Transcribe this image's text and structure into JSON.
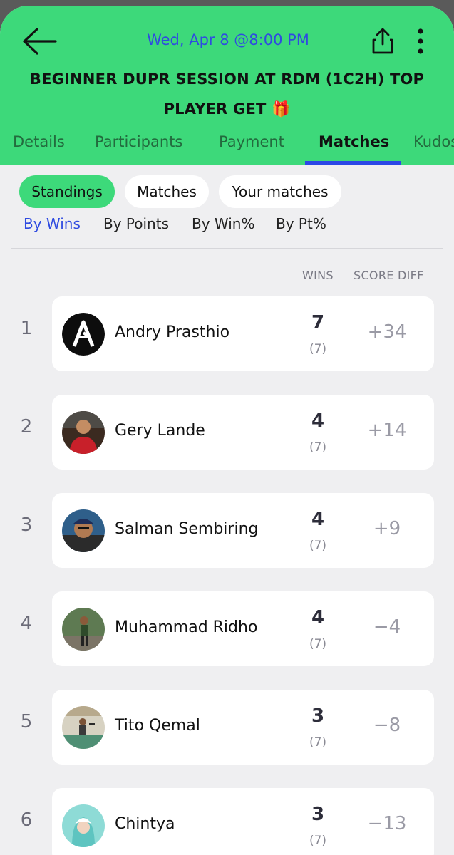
{
  "header": {
    "date": "Wed, Apr 8 @8:00 PM",
    "title_line1": "BEGINNER DUPR SESSION AT RDM (1C2H) TOP",
    "title_line2": "PLAYER GET 🎁"
  },
  "tabs": [
    {
      "label": "Details"
    },
    {
      "label": "Participants"
    },
    {
      "label": "Payment"
    },
    {
      "label": "Matches",
      "active": true
    },
    {
      "label": "Kudos"
    }
  ],
  "chips": [
    {
      "label": "Standings",
      "active": true
    },
    {
      "label": "Matches"
    },
    {
      "label": "Your matches"
    }
  ],
  "sorts": [
    {
      "label": "By Wins",
      "active": true
    },
    {
      "label": "By Points"
    },
    {
      "label": "By Win%"
    },
    {
      "label": "By Pt%"
    }
  ],
  "columns": {
    "wins": "WINS",
    "score_diff": "SCORE DIFF"
  },
  "standings": [
    {
      "rank": "1",
      "name": "Andry Prasthio",
      "wins": "7",
      "games": "(7)",
      "diff": "+34",
      "avatar": "logo-avatar"
    },
    {
      "rank": "2",
      "name": "Gery Lande",
      "wins": "4",
      "games": "(7)",
      "diff": "+14",
      "avatar": "photo-avatar"
    },
    {
      "rank": "3",
      "name": "Salman Sembiring",
      "wins": "4",
      "games": "(7)",
      "diff": "+9",
      "avatar": "photo-avatar"
    },
    {
      "rank": "4",
      "name": "Muhammad Ridho",
      "wins": "4",
      "games": "(7)",
      "diff": "−4",
      "avatar": "photo-avatar"
    },
    {
      "rank": "5",
      "name": "Tito Qemal",
      "wins": "3",
      "games": "(7)",
      "diff": "−8",
      "avatar": "photo-avatar"
    },
    {
      "rank": "6",
      "name": "Chintya",
      "wins": "3",
      "games": "(7)",
      "diff": "−13",
      "avatar": "photo-avatar"
    }
  ],
  "colors": {
    "brand_green": "#3dd97a",
    "accent_blue": "#2c47e6"
  }
}
